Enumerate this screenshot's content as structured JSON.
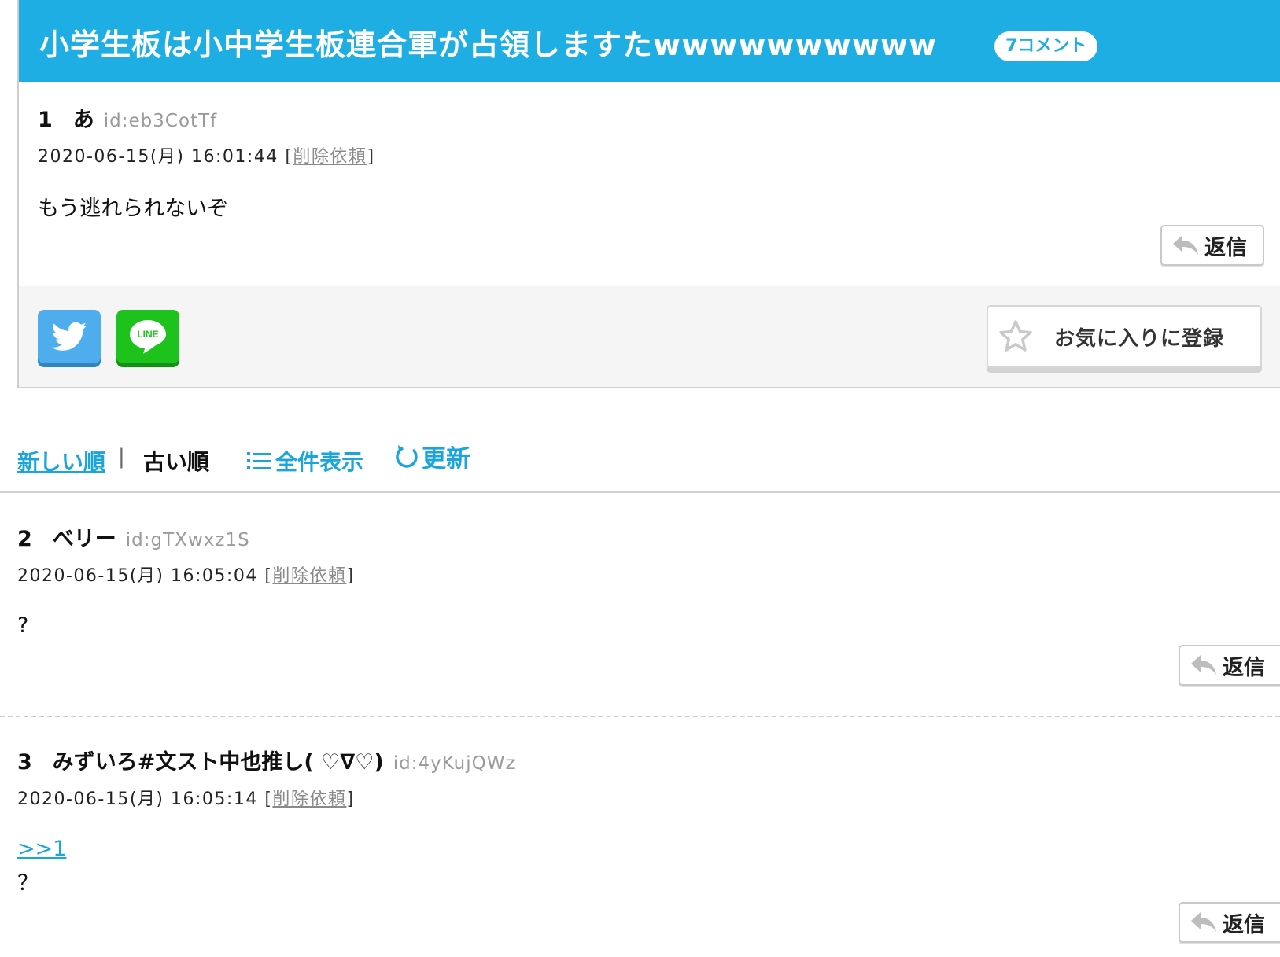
{
  "thread": {
    "title": "小学生板は小中学生板連合軍が占領しますたwwwwwwwwww",
    "comment_count": "7コメント"
  },
  "posts": [
    {
      "number": "1",
      "name": "あ",
      "id": "id:eb3CotTf",
      "date": "2020-06-15(月) 16:01:44",
      "delete_label": "削除依頼",
      "anchor": "",
      "body": "もう逃れられないぞ",
      "reply_label": "返信"
    },
    {
      "number": "2",
      "name": "べリー",
      "id": "id:gTXwxz1S",
      "date": "2020-06-15(月) 16:05:04",
      "delete_label": "削除依頼",
      "anchor": "",
      "body": "?",
      "reply_label": "返信"
    },
    {
      "number": "3",
      "name": "みずいろ#文スト中也推し( ♡∇♡)",
      "id": "id:4yKujQWz",
      "date": "2020-06-15(月) 16:05:14",
      "delete_label": "削除依頼",
      "anchor": ">>1",
      "body": "？",
      "reply_label": "返信"
    }
  ],
  "share": {
    "twitter_icon": "twitter-icon",
    "line_icon": "line-icon",
    "line_text": "LINE",
    "favorite_label": "お気に入りに登録"
  },
  "sort": {
    "newest": "新しい順",
    "separator": "|",
    "oldest": "古い順",
    "show_all": "全件表示",
    "refresh": "更新"
  },
  "colors": {
    "accent": "#1eaee3",
    "twitter": "#4eaded",
    "line": "#1ec21c",
    "link": "#1aa5dc"
  }
}
